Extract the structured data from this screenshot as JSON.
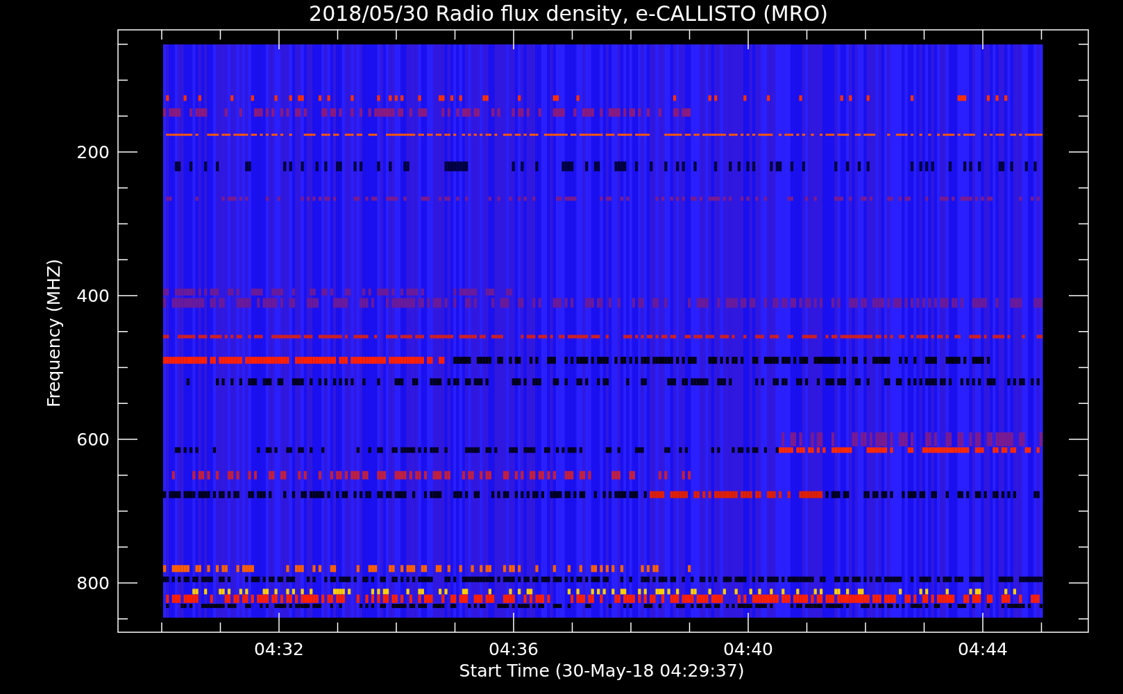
{
  "chart": {
    "title": "2018/05/30  Radio flux density, e-CALLISTO (MRO)",
    "ylabel": "Frequency (MHZ)",
    "yticks": [
      "200",
      "400",
      "600",
      "800"
    ],
    "xlabel": "Start Time (30-May-18 04:29:37)",
    "xticks": [
      "04:32",
      "04:36",
      "04:40",
      "04:44"
    ]
  }
}
